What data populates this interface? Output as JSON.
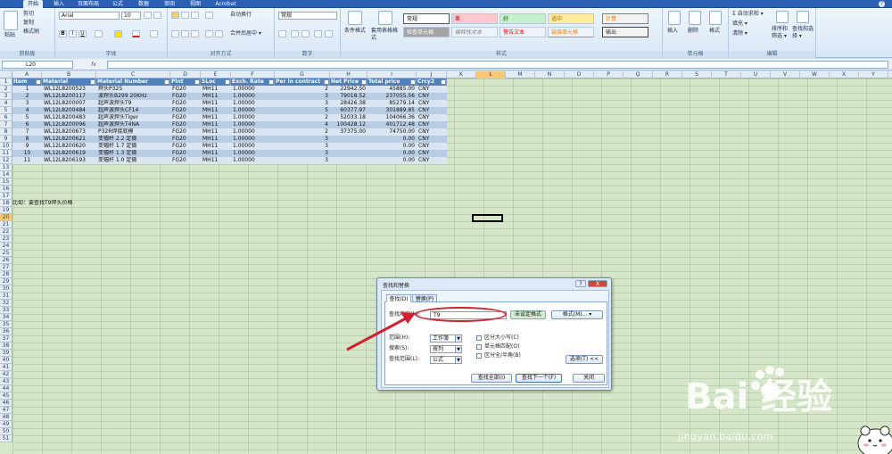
{
  "tabs": [
    "开始",
    "插入",
    "页面布局",
    "公式",
    "数据",
    "审阅",
    "视图",
    "Acrobat"
  ],
  "ribbon": {
    "clipboard": {
      "paste": "粘贴",
      "cut": "剪切",
      "copy": "复制",
      "format_painter": "格式刷",
      "label": "剪贴板"
    },
    "font": {
      "name": "Arial",
      "size": "10",
      "label": "字体"
    },
    "alignment": {
      "wrap": "自动换行",
      "merge": "合并后居中 ▾",
      "label": "对齐方式"
    },
    "number": {
      "format": "常规",
      "label": "数字"
    },
    "styles": {
      "cond_format": "条件格式",
      "table_format": "套用表格格式",
      "cells": [
        "常规",
        "差",
        "好",
        "适中",
        "计算",
        "检查单元格",
        "解释性文本",
        "警告文本",
        "链接单元格",
        "输出"
      ],
      "label": "样式"
    },
    "cells_group": {
      "insert": "插入",
      "delete": "删除",
      "format": "格式",
      "label": "单元格"
    },
    "editing": {
      "autosum": "Σ 自动求和 ▾",
      "fill": "填充 ▾",
      "clear": "清除 ▾",
      "sort": "排序和筛选 ▾",
      "find": "查找和选择 ▾",
      "label": "编辑"
    }
  },
  "formula_bar": {
    "name_box": "L20",
    "fx": "fx",
    "value": ""
  },
  "columns": [
    "A",
    "B",
    "C",
    "D",
    "E",
    "F",
    "G",
    "H",
    "I",
    "J",
    "K",
    "L",
    "M",
    "N",
    "O",
    "P",
    "Q",
    "R",
    "S",
    "T",
    "U",
    "V",
    "W",
    "X",
    "Y"
  ],
  "selected_column": "L",
  "selected_row": "20",
  "rows": [
    "1",
    "2",
    "3",
    "4",
    "5",
    "6",
    "7",
    "8",
    "9",
    "10",
    "11",
    "12",
    "13",
    "14",
    "15",
    "16",
    "17",
    "18",
    "19",
    "20",
    "21",
    "22",
    "23",
    "24",
    "25",
    "26",
    "27",
    "28",
    "29",
    "30",
    "31",
    "32",
    "33",
    "34",
    "35",
    "36",
    "37",
    "38",
    "39",
    "40",
    "41",
    "42",
    "43",
    "44",
    "45",
    "46",
    "47",
    "48",
    "49",
    "50",
    "51"
  ],
  "table": {
    "headers": [
      "Item",
      "Material",
      "Material Number",
      "Plnt",
      "SLoc",
      "Exch. Rate",
      "Per in contract",
      "Net Price",
      "Total price",
      "Crcy2"
    ],
    "rows": [
      [
        "1",
        "WL12L8200523",
        "焊头P32S",
        "FG20",
        "MH11",
        "1.00000",
        "2",
        "22942.50",
        "45885.00",
        "CNY"
      ],
      [
        "2",
        "WL12L8200117",
        "波焊头B299 20KHz",
        "FG20",
        "MH11",
        "1.00000",
        "3",
        "79018.52",
        "237055.56",
        "CNY"
      ],
      [
        "3",
        "WL12L8200007",
        "超声波焊头T9",
        "FG20",
        "MH11",
        "1.00000",
        "3",
        "28426.38",
        "85279.14",
        "CNY"
      ],
      [
        "4",
        "WL12L8200484",
        "超声波焊头CF14",
        "FG20",
        "MH11",
        "1.00000",
        "5",
        "60377.97",
        "301889.85",
        "CNY"
      ],
      [
        "5",
        "WL12L8200483",
        "超声波焊头Tiger",
        "FG20",
        "MH11",
        "1.00000",
        "2",
        "52033.18",
        "104066.36",
        "CNY"
      ],
      [
        "6",
        "WL12L8200096",
        "超声波焊头T4NA",
        "FG20",
        "MH11",
        "1.00000",
        "4",
        "100428.12",
        "401712.48",
        "CNY"
      ],
      [
        "7",
        "WL12L8200673",
        "P32R焊接底模",
        "FG20",
        "MH11",
        "1.00000",
        "2",
        "37375.00",
        "74750.00",
        "CNY"
      ],
      [
        "8",
        "WL12L8200621",
        "变幅杆 2.2 定做",
        "FG20",
        "MH11",
        "1.00000",
        "3",
        "",
        "0.00",
        "CNY"
      ],
      [
        "9",
        "WL12L8200620",
        "变幅杆 1.7 定做",
        "FG20",
        "MH11",
        "1.00000",
        "3",
        "",
        "0.00",
        "CNY"
      ],
      [
        "10",
        "WL12L8200619",
        "变幅杆 1.3 定做",
        "FG20",
        "MH11",
        "1.00000",
        "3",
        "",
        "0.00",
        "CNY"
      ],
      [
        "11",
        "WL12L8206193",
        "变幅杆 1.0 定做",
        "FG20",
        "MH11",
        "1.00000",
        "3",
        "",
        "0.00",
        "CNY"
      ]
    ]
  },
  "note": "比如：要查找T9焊头价格",
  "dialog": {
    "title": "查找和替换",
    "help": "?",
    "close": "X",
    "tab_find": "查找(D)",
    "tab_replace": "替换(P)",
    "find_label": "查找内容(N):",
    "find_value": "T9",
    "no_format": "未设定格式",
    "format_btn": "格式(M)... ▾",
    "within_label": "范围(H):",
    "within_value": "工作簿",
    "search_label": "搜索(S):",
    "search_value": "按列",
    "lookin_label": "查找范围(L):",
    "lookin_value": "公式",
    "match_case": "区分大小写(C)",
    "match_entire": "单元格匹配(O)",
    "match_byte": "区分全/半角(B)",
    "options_btn": "选项(T) <<",
    "find_all": "查找全部(I)",
    "find_next": "查找下一个(F)",
    "close_btn": "关闭"
  },
  "watermark": {
    "brand": "Bai 经验",
    "url": "jingyan.baidu.com"
  },
  "colors": {
    "table_header": "#4f81bd",
    "row_light": "#dbe5f1",
    "row_dark": "#b8cce4",
    "sheet_bg": "#d6e6c8",
    "annotation_red": "#d2202d",
    "selected_header": "#f6c777"
  }
}
